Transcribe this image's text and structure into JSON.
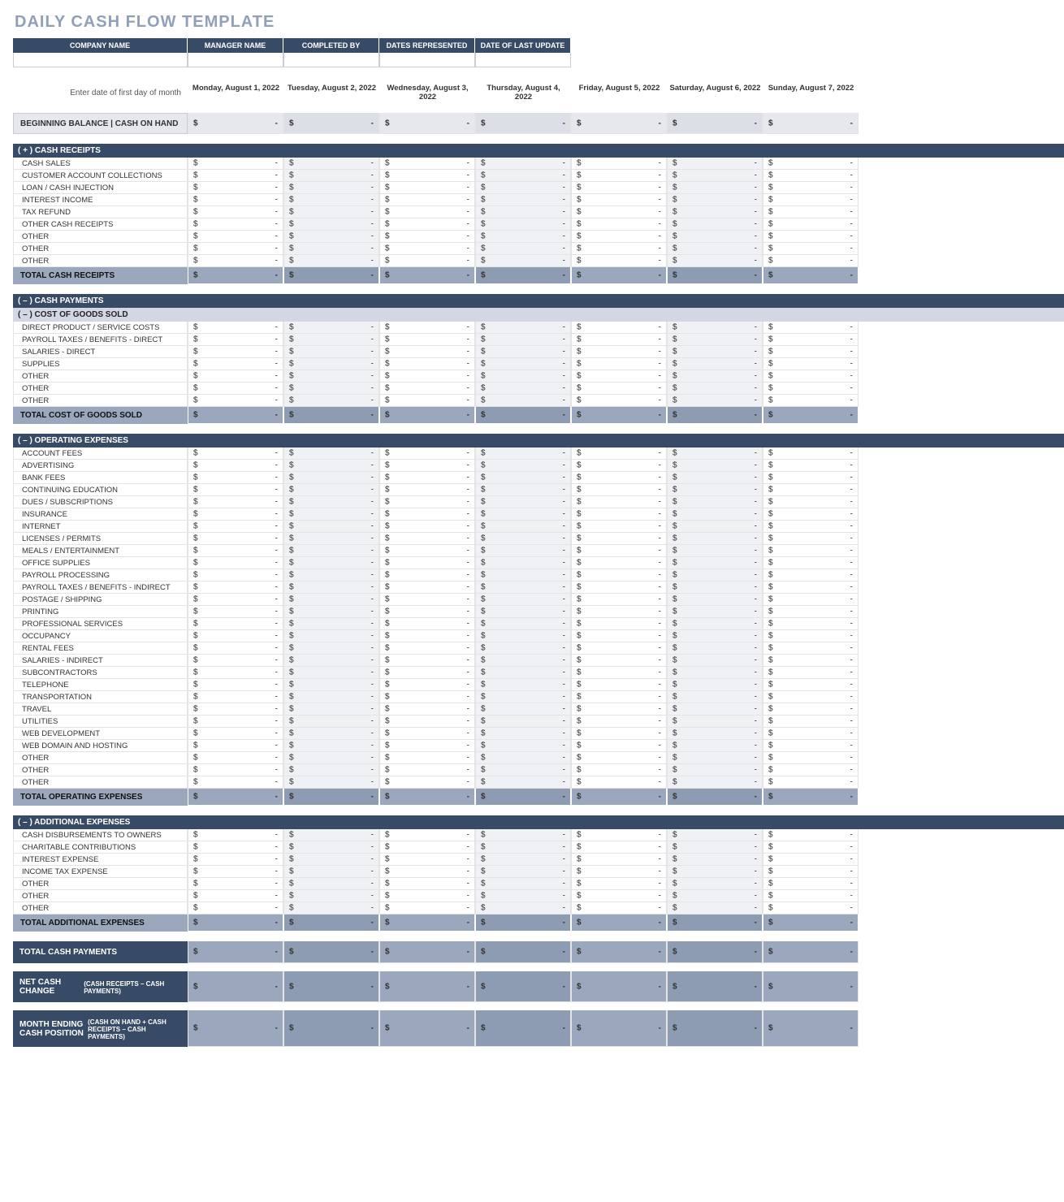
{
  "title": "DAILY CASH FLOW TEMPLATE",
  "headers": [
    "COMPANY NAME",
    "MANAGER NAME",
    "COMPLETED BY",
    "DATES REPRESENTED",
    "DATE OF LAST UPDATE"
  ],
  "date_prompt": "Enter date of first day of month",
  "dates": [
    "Monday, August 1, 2022",
    "Tuesday, August 2, 2022",
    "Wednesday, August 3, 2022",
    "Thursday, August 4, 2022",
    "Friday, August 5, 2022",
    "Saturday, August 6, 2022",
    "Sunday, August 7, 2022"
  ],
  "beginning_balance_label": "BEGINNING BALANCE  |  CASH ON HAND",
  "currency_symbol": "$",
  "dash": "-",
  "sections": {
    "cash_receipts": {
      "header": "( + )   CASH RECEIPTS",
      "items": [
        "CASH SALES",
        "CUSTOMER ACCOUNT COLLECTIONS",
        "LOAN / CASH INJECTION",
        "INTEREST INCOME",
        "TAX REFUND",
        "OTHER CASH RECEIPTS",
        "OTHER",
        "OTHER",
        "OTHER"
      ],
      "total_label": "TOTAL CASH RECEIPTS"
    },
    "cash_payments_header": "( – )   CASH PAYMENTS",
    "cogs": {
      "header": "( – )   COST OF GOODS SOLD",
      "items": [
        "DIRECT PRODUCT / SERVICE COSTS",
        "PAYROLL TAXES / BENEFITS - DIRECT",
        "SALARIES - DIRECT",
        "SUPPLIES",
        "OTHER",
        "OTHER",
        "OTHER"
      ],
      "total_label": "TOTAL COST OF GOODS SOLD"
    },
    "opex": {
      "header": "( – )   OPERATING EXPENSES",
      "items": [
        "ACCOUNT FEES",
        "ADVERTISING",
        "BANK FEES",
        "CONTINUING EDUCATION",
        "DUES / SUBSCRIPTIONS",
        "INSURANCE",
        "INTERNET",
        "LICENSES / PERMITS",
        "MEALS / ENTERTAINMENT",
        "OFFICE SUPPLIES",
        "PAYROLL PROCESSING",
        "PAYROLL TAXES / BENEFITS - INDIRECT",
        "POSTAGE / SHIPPING",
        "PRINTING",
        "PROFESSIONAL SERVICES",
        "OCCUPANCY",
        "RENTAL FEES",
        "SALARIES - INDIRECT",
        "SUBCONTRACTORS",
        "TELEPHONE",
        "TRANSPORTATION",
        "TRAVEL",
        "UTILITIES",
        "WEB DEVELOPMENT",
        "WEB DOMAIN AND HOSTING",
        "OTHER",
        "OTHER",
        "OTHER"
      ],
      "total_label": "TOTAL OPERATING EXPENSES"
    },
    "addl": {
      "header": "( – )   ADDITIONAL EXPENSES",
      "items": [
        "CASH DISBURSEMENTS TO OWNERS",
        "CHARITABLE CONTRIBUTIONS",
        "INTEREST EXPENSE",
        "INCOME TAX EXPENSE",
        "OTHER",
        "OTHER",
        "OTHER"
      ],
      "total_label": "TOTAL ADDITIONAL EXPENSES"
    }
  },
  "grand": {
    "total_payments": "TOTAL CASH PAYMENTS",
    "net_change": "NET CASH CHANGE",
    "net_change_sub": "(CASH RECEIPTS – CASH PAYMENTS)",
    "ending": "MONTH ENDING CASH POSITION",
    "ending_sub": "(CASH ON HAND + CASH RECEIPTS – CASH PAYMENTS)"
  }
}
